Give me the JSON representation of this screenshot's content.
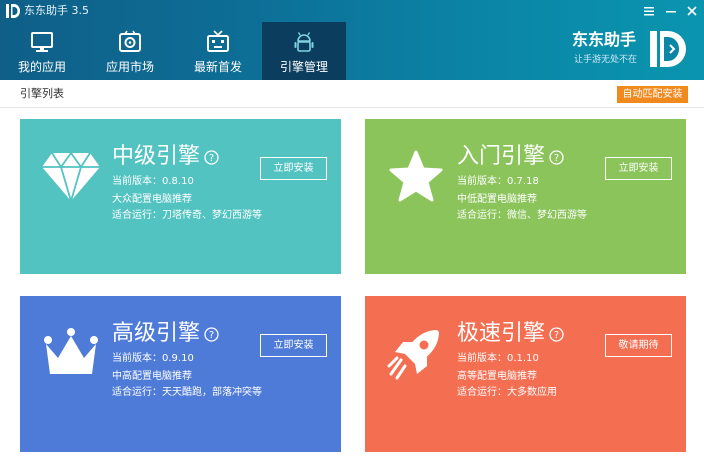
{
  "window": {
    "title": "东东助手 3.5"
  },
  "nav": {
    "tabs": [
      {
        "label": "我的应用",
        "icon": "monitor-icon"
      },
      {
        "label": "应用市场",
        "icon": "app-store-icon"
      },
      {
        "label": "最新首发",
        "icon": "tv-icon"
      },
      {
        "label": "引擎管理",
        "icon": "android-icon",
        "active": true
      }
    ]
  },
  "brand": {
    "name": "东东助手",
    "slogan": "让手游无处不在"
  },
  "subbar": {
    "title": "引擎列表",
    "auto_button": "自动匹配安装"
  },
  "colors": {
    "header": "#0d6e96",
    "active_tab": "#0a3d5e",
    "accent_orange": "#f08a1f",
    "card_teal": "#52c3c1",
    "card_green": "#8bc45a",
    "card_blue": "#4f7bd8",
    "card_coral": "#f46e52"
  },
  "cards": [
    {
      "title": "中级引擎",
      "version": "当前版本：0.8.10",
      "recommend": "大众配置电脑推荐",
      "suitable": "适合运行：刀塔传奇、梦幻西游等",
      "button": "立即安装",
      "icon": "diamond-icon",
      "color": "#52c3c1"
    },
    {
      "title": "入门引擎",
      "version": "当前版本：0.7.18",
      "recommend": "中低配置电脑推荐",
      "suitable": "适合运行：微信、梦幻西游等",
      "button": "立即安装",
      "icon": "star-icon",
      "color": "#8bc45a"
    },
    {
      "title": "高级引擎",
      "version": "当前版本：0.9.10",
      "recommend": "中高配置电脑推荐",
      "suitable": "适合运行：天天酷跑，部落冲突等",
      "button": "立即安装",
      "icon": "crown-icon",
      "color": "#4f7bd8"
    },
    {
      "title": "极速引擎",
      "version": "当前版本：0.1.10",
      "recommend": "高等配置电脑推荐",
      "suitable": "适合运行：大多数应用",
      "button": "敬请期待",
      "icon": "rocket-icon",
      "color": "#f46e52"
    }
  ]
}
